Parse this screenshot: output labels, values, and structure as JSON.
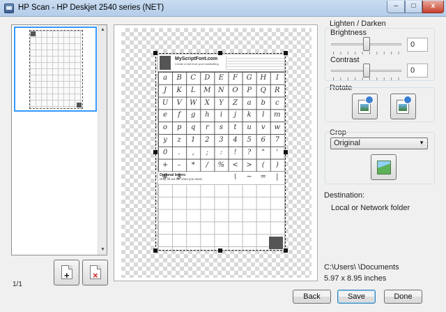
{
  "window": {
    "title": "HP Scan - HP Deskjet 2540 series (NET)",
    "minimize_glyph": "–",
    "maximize_glyph": "□",
    "close_glyph": "x"
  },
  "thumbnails": {
    "page_count": "1/1",
    "add_glyph": "+",
    "delete_glyph": "×"
  },
  "preview": {
    "site_name": "MyScriptFont.com",
    "site_tagline": "Create a font from your handwriting",
    "optional_label": "Optional letters:",
    "optional_sub": "Only fill out the ones you need.",
    "glyph_rows": [
      [
        "a",
        "B",
        "C",
        "D",
        "E",
        "F",
        "G",
        "H",
        "I"
      ],
      [
        "J",
        "K",
        "L",
        "M",
        "N",
        "O",
        "P",
        "Q",
        "R"
      ],
      [
        "U",
        "V",
        "W",
        "X",
        "Y",
        "Z",
        "a",
        "b",
        "c"
      ],
      [
        "e",
        "f",
        "g",
        "h",
        "i",
        "j",
        "k",
        "l",
        "m"
      ],
      [
        "o",
        "p",
        "q",
        "r",
        "s",
        "t",
        "u",
        "v",
        "w"
      ],
      [
        "y",
        "z",
        "1",
        "2",
        "3",
        "4",
        "5",
        "6",
        "7"
      ],
      [
        "0",
        ".",
        ",",
        ";",
        ":",
        "!",
        "?",
        "\"",
        "'"
      ],
      [
        "+",
        "–",
        "*",
        "/",
        "%",
        "<",
        ">",
        "(",
        ")"
      ],
      [
        "#",
        "$",
        "",
        "",
        "",
        "\\",
        "~",
        "=",
        "|"
      ]
    ]
  },
  "adjust": {
    "group_label": "Lighten / Darken",
    "brightness_label": "Brightness",
    "brightness_value": "0",
    "contrast_label": "Contrast",
    "contrast_value": "0"
  },
  "rotate": {
    "group_label": "Rotate"
  },
  "crop": {
    "group_label": "Crop",
    "selected_option": "Original"
  },
  "destination": {
    "label": "Destination:",
    "value": "Local or Network folder"
  },
  "save_path": "C:\\Users\\          \\Documents",
  "size": "5.97 x 8.95 inches",
  "buttons": {
    "back": "Back",
    "save": "Save",
    "done": "Done"
  }
}
